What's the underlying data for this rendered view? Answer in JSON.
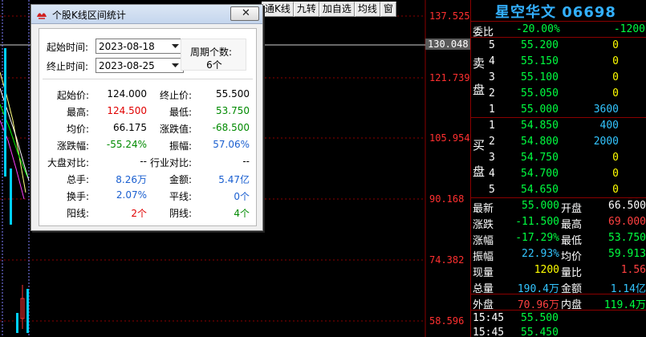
{
  "toolbar": {
    "items": [
      "通K线",
      "九转",
      "加自选",
      "均线",
      "窗"
    ]
  },
  "chart": {
    "price_labels": [
      "137.525",
      "130.048",
      "121.739",
      "105.954",
      "90.168",
      "74.382",
      "58.596"
    ],
    "current_price_label": "130.048",
    "colors": {
      "up": "#ff3030",
      "down": "#00d0ff",
      "ma": "#ffff80",
      "axis": "#8b0000"
    }
  },
  "panel": {
    "title": "星空华文 06698",
    "weibi": {
      "label": "委比",
      "pct": "-20.00%",
      "diff": "-1200"
    },
    "sell_label_1": "卖",
    "sell_label_2": "盘",
    "buy_label_1": "买",
    "buy_label_2": "盘",
    "sell": [
      {
        "level": "5",
        "price": "55.200",
        "vol": "0"
      },
      {
        "level": "4",
        "price": "55.150",
        "vol": "0"
      },
      {
        "level": "3",
        "price": "55.100",
        "vol": "0"
      },
      {
        "level": "2",
        "price": "55.050",
        "vol": "0"
      },
      {
        "level": "1",
        "price": "55.000",
        "vol": "3600"
      }
    ],
    "buy": [
      {
        "level": "1",
        "price": "54.850",
        "vol": "400"
      },
      {
        "level": "2",
        "price": "54.800",
        "vol": "2000"
      },
      {
        "level": "3",
        "price": "54.750",
        "vol": "0"
      },
      {
        "level": "4",
        "price": "54.700",
        "vol": "0"
      },
      {
        "level": "5",
        "price": "54.650",
        "vol": "0"
      }
    ],
    "quote": [
      {
        "l1": "最新",
        "v1": "55.000",
        "l2": "开盘",
        "v2": "66.500"
      },
      {
        "l1": "涨跌",
        "v1": "-11.500",
        "l2": "最高",
        "v2": "69.000"
      },
      {
        "l1": "涨幅",
        "v1": "-17.29%",
        "l2": "最低",
        "v2": "53.750"
      },
      {
        "l1": "振幅",
        "v1": "22.93%",
        "l2": "均价",
        "v2": "59.913"
      },
      {
        "l1": "现量",
        "v1": "1200",
        "l2": "量比",
        "v2": "1.56"
      },
      {
        "l1": "总量",
        "v1": "190.4万",
        "l2": "金额",
        "v2": "1.14亿"
      },
      {
        "l1": "外盘",
        "v1": "70.96万",
        "l2": "内盘",
        "v2": "119.4万"
      }
    ],
    "ticks": [
      {
        "time": "15:45",
        "price": "55.500"
      },
      {
        "time": "15:45",
        "price": "55.450"
      }
    ]
  },
  "dialog": {
    "title": "个股K线区间统计",
    "start_label": "起始时间:",
    "start_date": "2023-08-18",
    "end_label": "终止时间:",
    "end_date": "2023-08-25",
    "period_label": "周期个数:",
    "period_value": "6个",
    "stats": [
      {
        "l1": "起始价:",
        "v1": "124.000",
        "c1": "black",
        "l2": "终止价:",
        "v2": "55.500",
        "c2": "black"
      },
      {
        "l1": "最高:",
        "v1": "124.500",
        "c1": "red",
        "l2": "最低:",
        "v2": "53.750",
        "c2": "green"
      },
      {
        "l1": "均价:",
        "v1": "66.175",
        "c1": "black",
        "l2": "涨跌值:",
        "v2": "-68.500",
        "c2": "green"
      },
      {
        "l1": "涨跌幅:",
        "v1": "-55.24%",
        "c1": "green",
        "l2": "振幅:",
        "v2": "57.06%",
        "c2": "blue"
      },
      {
        "l1": "大盘对比:",
        "v1": "--",
        "c1": "black",
        "l2": "行业对比:",
        "v2": "--",
        "c2": "black"
      },
      {
        "l1": "总手:",
        "v1": "8.26万",
        "c1": "blue",
        "l2": "金额:",
        "v2": "5.47亿",
        "c2": "blue"
      },
      {
        "l1": "换手:",
        "v1": "2.07%",
        "c1": "blue",
        "l2": "平线:",
        "v2": "0个",
        "c2": "blue"
      },
      {
        "l1": "阳线:",
        "v1": "2个",
        "c1": "red",
        "l2": "阴线:",
        "v2": "4个",
        "c2": "green"
      }
    ]
  }
}
